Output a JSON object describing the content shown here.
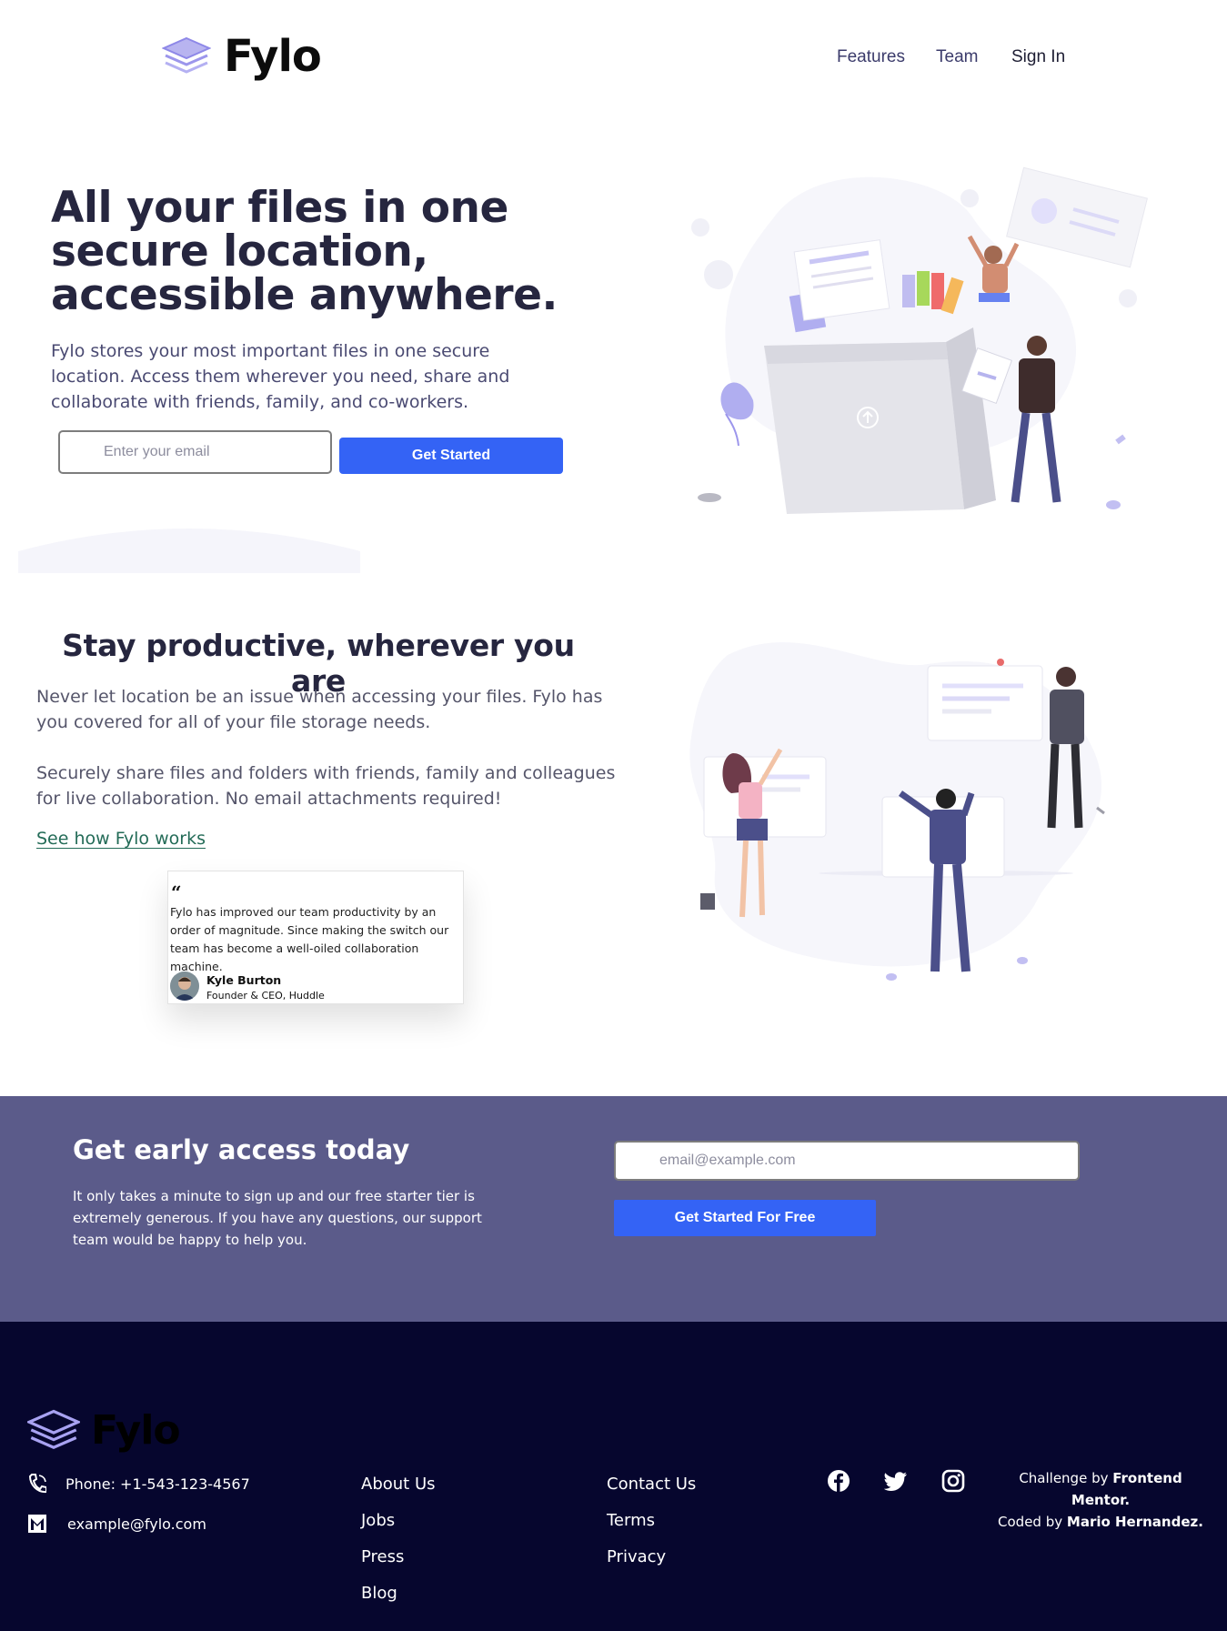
{
  "header": {
    "logo_text": "Fylo",
    "nav": {
      "features": "Features",
      "team": "Team",
      "sign_in": "Sign In"
    }
  },
  "hero": {
    "title": "All your files in one secure location, accessible anywhere.",
    "description": "Fylo stores your most important files in one secure location. Access them wherever you need, share and collaborate with friends, family, and co-workers.",
    "email_placeholder": "Enter your email",
    "cta_label": "Get Started"
  },
  "productive": {
    "title": "Stay productive, wherever you are",
    "paragraph_1": "Never let location be an issue when accessing your files. Fylo has you covered for all of your file storage needs.",
    "paragraph_2": "Securely share files and folders with friends, family and colleagues for live collaboration. No email attachments required!",
    "link_label": "See how Fylo works",
    "testimonial": {
      "quote_mark": "“",
      "text": "Fylo has improved our team productivity by an order of magnitude. Since making the switch our team has become a well-oiled collaboration machine.",
      "name": "Kyle Burton",
      "role": "Founder & CEO, Huddle"
    }
  },
  "early_access": {
    "title": "Get early access today",
    "description": "It only takes a minute to sign up and our free starter tier is extremely generous. If you have any questions, our support team would be happy to help you.",
    "email_placeholder": "email@example.com",
    "cta_label": "Get Started For Free"
  },
  "footer": {
    "logo_text": "Fylo",
    "phone": "Phone: +1-543-123-4567",
    "email": "example@fylo.com",
    "links_col1": [
      "About Us",
      "Jobs",
      "Press",
      "Blog"
    ],
    "links_col2": [
      "Contact Us",
      "Terms",
      "Privacy"
    ],
    "social_icons": [
      "facebook-icon",
      "twitter-icon",
      "instagram-icon"
    ],
    "credit_prefix_1": "Challenge by ",
    "credit_name_1": "Frontend Mentor.",
    "credit_prefix_2": "Coded by ",
    "credit_name_2": "Mario Hernandez."
  },
  "colors": {
    "primary_blue": "#3463f5",
    "early_access_bg": "#5b5b8a",
    "footer_bg": "#06062e",
    "heading_dark": "#26263f",
    "link_green": "#236b57"
  }
}
